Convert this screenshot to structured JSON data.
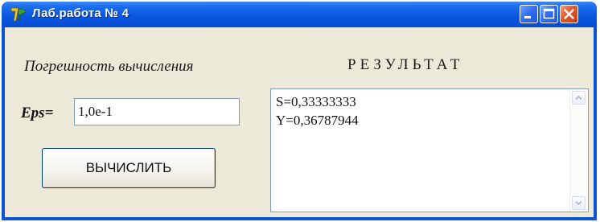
{
  "window": {
    "title": "Лаб.работа № 4",
    "app_icon": "delphi-icon",
    "controls": {
      "minimize": "minimize-icon",
      "maximize": "maximize-icon",
      "close": "close-icon"
    },
    "accent": "#0a58e0",
    "close_color": "#e2582e"
  },
  "form": {
    "error_label": "Погрешность вычисления",
    "result_label": "РЕЗУЛЬТАТ",
    "eps_label": "Eps=",
    "eps_value": "1,0e-1",
    "calc_button_label": "ВЫЧИСЛИТЬ",
    "results": [
      "S=0,33333333",
      "Y=0,36787944"
    ],
    "scrollbar": {
      "up": "scroll-up-arrow-icon",
      "down": "scroll-down-arrow-icon"
    }
  }
}
